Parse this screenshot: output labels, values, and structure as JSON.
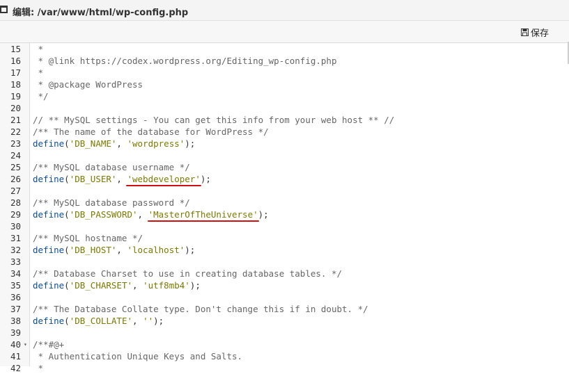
{
  "window": {
    "title": "编辑: /var/www/html/wp-config.php"
  },
  "toolbar": {
    "save_label": "保存"
  },
  "editor": {
    "lines": [
      {
        "n": "15",
        "tokens": [
          {
            "t": "c",
            "v": " *"
          }
        ]
      },
      {
        "n": "16",
        "tokens": [
          {
            "t": "c",
            "v": " * @link https://codex.wordpress.org/Editing_wp-config.php"
          }
        ]
      },
      {
        "n": "17",
        "tokens": [
          {
            "t": "c",
            "v": " *"
          }
        ]
      },
      {
        "n": "18",
        "tokens": [
          {
            "t": "c",
            "v": " * @package WordPress"
          }
        ]
      },
      {
        "n": "19",
        "tokens": [
          {
            "t": "c",
            "v": " */"
          }
        ]
      },
      {
        "n": "20",
        "tokens": []
      },
      {
        "n": "21",
        "tokens": [
          {
            "t": "c",
            "v": "// ** MySQL settings - You can get this info from your web host ** //"
          }
        ]
      },
      {
        "n": "22",
        "tokens": [
          {
            "t": "c",
            "v": "/** The name of the database for WordPress */"
          }
        ]
      },
      {
        "n": "23",
        "tokens": [
          {
            "t": "f",
            "v": "define"
          },
          {
            "t": "p",
            "v": "("
          },
          {
            "t": "s",
            "v": "'DB_NAME'"
          },
          {
            "t": "p",
            "v": ", "
          },
          {
            "t": "s",
            "v": "'wordpress'"
          },
          {
            "t": "p",
            "v": ");"
          }
        ]
      },
      {
        "n": "24",
        "tokens": []
      },
      {
        "n": "25",
        "tokens": [
          {
            "t": "c",
            "v": "/** MySQL database username */"
          }
        ]
      },
      {
        "n": "26",
        "tokens": [
          {
            "t": "f",
            "v": "define"
          },
          {
            "t": "p",
            "v": "("
          },
          {
            "t": "s",
            "v": "'DB_USER'"
          },
          {
            "t": "p",
            "v": ", "
          },
          {
            "t": "s",
            "v": "'webdeveloper'"
          },
          {
            "t": "p",
            "v": ");"
          }
        ]
      },
      {
        "n": "27",
        "tokens": []
      },
      {
        "n": "28",
        "tokens": [
          {
            "t": "c",
            "v": "/** MySQL database password */"
          }
        ]
      },
      {
        "n": "29",
        "tokens": [
          {
            "t": "f",
            "v": "define"
          },
          {
            "t": "p",
            "v": "("
          },
          {
            "t": "s",
            "v": "'DB_PASSWORD'"
          },
          {
            "t": "p",
            "v": ", "
          },
          {
            "t": "s",
            "v": "'MasterOfTheUniverse'"
          },
          {
            "t": "p",
            "v": ");"
          }
        ]
      },
      {
        "n": "30",
        "tokens": []
      },
      {
        "n": "31",
        "tokens": [
          {
            "t": "c",
            "v": "/** MySQL hostname */"
          }
        ]
      },
      {
        "n": "32",
        "tokens": [
          {
            "t": "f",
            "v": "define"
          },
          {
            "t": "p",
            "v": "("
          },
          {
            "t": "s",
            "v": "'DB_HOST'"
          },
          {
            "t": "p",
            "v": ", "
          },
          {
            "t": "s",
            "v": "'localhost'"
          },
          {
            "t": "p",
            "v": ");"
          }
        ]
      },
      {
        "n": "33",
        "tokens": []
      },
      {
        "n": "34",
        "tokens": [
          {
            "t": "c",
            "v": "/** Database Charset to use in creating database tables. */"
          }
        ]
      },
      {
        "n": "35",
        "tokens": [
          {
            "t": "f",
            "v": "define"
          },
          {
            "t": "p",
            "v": "("
          },
          {
            "t": "s",
            "v": "'DB_CHARSET'"
          },
          {
            "t": "p",
            "v": ", "
          },
          {
            "t": "s",
            "v": "'utf8mb4'"
          },
          {
            "t": "p",
            "v": ");"
          }
        ]
      },
      {
        "n": "36",
        "tokens": []
      },
      {
        "n": "37",
        "tokens": [
          {
            "t": "c",
            "v": "/** The Database Collate type. Don't change this if in doubt. */"
          }
        ]
      },
      {
        "n": "38",
        "tokens": [
          {
            "t": "f",
            "v": "define"
          },
          {
            "t": "p",
            "v": "("
          },
          {
            "t": "s",
            "v": "'DB_COLLATE'"
          },
          {
            "t": "p",
            "v": ", "
          },
          {
            "t": "s",
            "v": "''"
          },
          {
            "t": "p",
            "v": ");"
          }
        ]
      },
      {
        "n": "39",
        "tokens": []
      },
      {
        "n": "40",
        "fold": true,
        "tokens": [
          {
            "t": "c",
            "v": "/**#@+"
          }
        ]
      },
      {
        "n": "41",
        "tokens": [
          {
            "t": "c",
            "v": " * Authentication Unique Keys and Salts."
          }
        ]
      },
      {
        "n": "42",
        "tokens": [
          {
            "t": "c",
            "v": " *"
          }
        ]
      }
    ]
  },
  "annotations": {
    "color": "#d01010",
    "underlined_values": [
      "'webdeveloper'",
      "'MasterOfTheUniverse'"
    ]
  },
  "icons": {
    "window": "window-icon",
    "save": "save-icon",
    "fold": "fold-arrow-icon"
  }
}
